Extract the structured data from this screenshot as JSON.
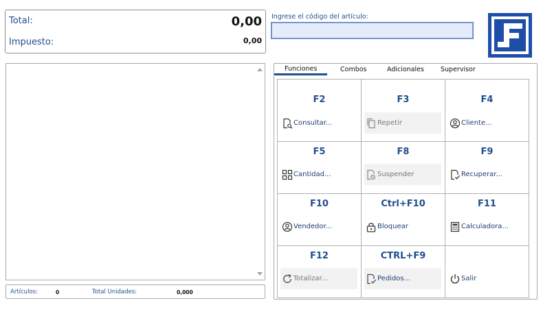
{
  "totals": {
    "total_label": "Total:",
    "total_value": "0,00",
    "tax_label": "Impuesto:",
    "tax_value": "0,00"
  },
  "article_code": {
    "label": "Ingrese el código del artículo:",
    "value": ""
  },
  "summary": {
    "articles_label": "Artículos:",
    "articles_value": "0",
    "units_label": "Total Unidades:",
    "units_value": "0,000"
  },
  "tabs": [
    {
      "label": "Funciones",
      "active": true
    },
    {
      "label": "Combos",
      "active": false
    },
    {
      "label": "Adicionales",
      "active": false
    },
    {
      "label": "Supervisor",
      "active": false
    }
  ],
  "functions": [
    {
      "key": "F2",
      "label": "Consultar...",
      "icon": "search-doc-icon",
      "enabled": true
    },
    {
      "key": "F3",
      "label": "Repetir",
      "icon": "copy-icon",
      "enabled": false
    },
    {
      "key": "F4",
      "label": "Cliente...",
      "icon": "user-icon",
      "enabled": true
    },
    {
      "key": "F5",
      "label": "Cantidad...",
      "icon": "grid-icon",
      "enabled": true
    },
    {
      "key": "F8",
      "label": "Suspender",
      "icon": "pause-doc-icon",
      "enabled": false
    },
    {
      "key": "F9",
      "label": "Recuperar...",
      "icon": "check-doc-icon",
      "enabled": true
    },
    {
      "key": "F10",
      "label": "Vendedor...",
      "icon": "user-icon",
      "enabled": true
    },
    {
      "key": "Ctrl+F10",
      "label": "Bloquear",
      "icon": "lock-icon",
      "enabled": true
    },
    {
      "key": "F11",
      "label": "Calculadora...",
      "icon": "calculator-icon",
      "enabled": true
    },
    {
      "key": "F12",
      "label": "Totalizar...",
      "icon": "refresh-icon",
      "enabled": false
    },
    {
      "key": "CTRL+F9",
      "label": "Pedidos...",
      "icon": "check-doc-icon",
      "enabled": false
    },
    {
      "key": "",
      "label": "Salir",
      "icon": "power-icon",
      "enabled": true
    }
  ],
  "colors": {
    "accent": "#1f4e8f",
    "logo_blue": "#1f4ea8",
    "input_bg": "#e5ecfb"
  }
}
